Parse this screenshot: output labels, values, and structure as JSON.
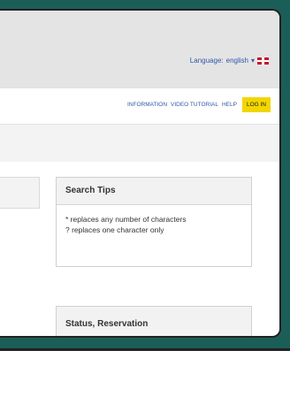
{
  "header": {
    "language_label": "Language:",
    "language_value": "english",
    "flag_icon": "uk-flag-icon"
  },
  "nav": {
    "items": [
      "INFORMATION",
      "VIDEO TUTORIAL",
      "HELP"
    ],
    "login_label": "LOG IN"
  },
  "search_tips": {
    "title": "Search Tips",
    "line1": "* replaces any number of characters",
    "line2": "? replaces one character only"
  },
  "status_box": {
    "title": "Status, Reservation"
  },
  "colors": {
    "frame_bg": "#1b5e58",
    "login_bg": "#f2d600",
    "link": "#2f59a8"
  }
}
